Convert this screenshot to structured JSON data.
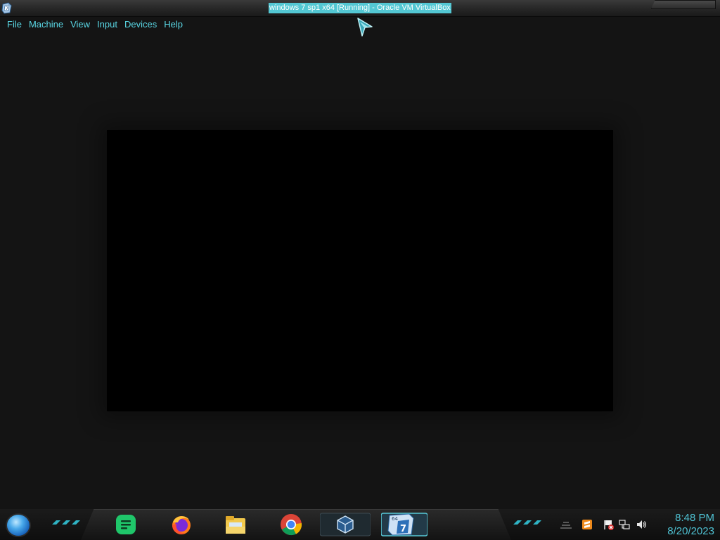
{
  "window": {
    "title": "windows 7 sp1 x64 [Running] - Oracle VM VirtualBox",
    "app_icon": "virtualbox-icon"
  },
  "menu": {
    "items": [
      "File",
      "Machine",
      "View",
      "Input",
      "Devices",
      "Help"
    ]
  },
  "taskbar": {
    "start_icon": "windows-orb-icon",
    "pinned": [
      {
        "name": "notes-app-icon"
      },
      {
        "name": "firefox-icon"
      },
      {
        "name": "file-explorer-icon"
      },
      {
        "name": "chrome-icon"
      },
      {
        "name": "virtualbox-icon"
      },
      {
        "name": "windows-7-vm-icon",
        "badge": "64",
        "label": "7"
      }
    ],
    "tray": {
      "icons": [
        "show-hidden-icons-icon",
        "sublime-text-icon",
        "action-center-flag-icon",
        "network-icon",
        "volume-icon"
      ],
      "time": "8:48 PM",
      "date": "8/20/2023"
    }
  },
  "colors": {
    "accent": "#5ad8e6",
    "title_highlight": "#53c7d3",
    "background": "#141414",
    "vm_screen": "#000000"
  }
}
